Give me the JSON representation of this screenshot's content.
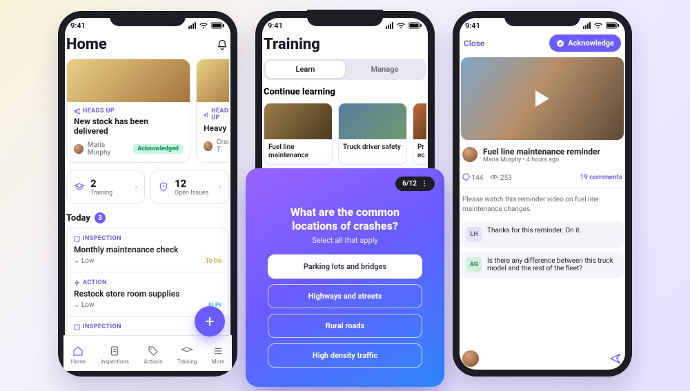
{
  "status_time": "9:41",
  "colors": {
    "accent": "#6b5cff"
  },
  "home": {
    "title": "Home",
    "feed": [
      {
        "tag": "HEADS UP",
        "title": "New stock has been delivered",
        "author": "Maria Murphy",
        "status": "Acknowledged"
      },
      {
        "tag": "HEADS UP",
        "title": "Heavy st",
        "author": "Craig T"
      }
    ],
    "stats": [
      {
        "count": "2",
        "label": "Training"
      },
      {
        "count": "12",
        "label": "Open Issues"
      }
    ],
    "today_label": "Today",
    "today_count": "3",
    "tasks": [
      {
        "kind": "INSPECTION",
        "title": "Monthly maintenance check",
        "priority": "Low",
        "status": "To Do",
        "status_color": "#d6a93c"
      },
      {
        "kind": "ACTION",
        "title": "Restock store room supplies",
        "priority": "Low",
        "status": "In Pr",
        "status_color": "#3bbff0"
      },
      {
        "kind": "INSPECTION",
        "title": "",
        "priority": "",
        "status": ""
      }
    ],
    "tabbar": [
      "Home",
      "Inspections",
      "Actions",
      "Training",
      "More"
    ]
  },
  "training": {
    "title": "Training",
    "segments": [
      "Learn",
      "Manage"
    ],
    "continue_label": "Continue learning",
    "tiles": [
      {
        "label": "Fuel line maintenance"
      },
      {
        "label": "Truck driver safety"
      },
      {
        "label": "Pr ec"
      }
    ]
  },
  "quiz": {
    "progress": "6/12",
    "question": "What are the common locations of crashes?",
    "subtitle": "Select all that apply",
    "options": [
      {
        "label": "Parking lots and bridges",
        "selected": true
      },
      {
        "label": "Highways and streets",
        "selected": false
      },
      {
        "label": "Rural roads",
        "selected": false
      },
      {
        "label": "High density traffic",
        "selected": false
      }
    ]
  },
  "post": {
    "close": "Close",
    "ack": "Acknowledge",
    "title": "Fuel line maintenance reminder",
    "author": "Maria Murphy",
    "age": "4 hours ago",
    "reactions": "144",
    "views": "253",
    "comments_label": "19 comments",
    "description": "Please watch this reminder video on fuel line maintenance changes.",
    "comments": [
      {
        "initials": "LH",
        "text": "Thanks for this reminder. On it."
      },
      {
        "initials": "AG",
        "text": "Is there any difference between this truck model and the rest of the fleet?"
      }
    ]
  }
}
